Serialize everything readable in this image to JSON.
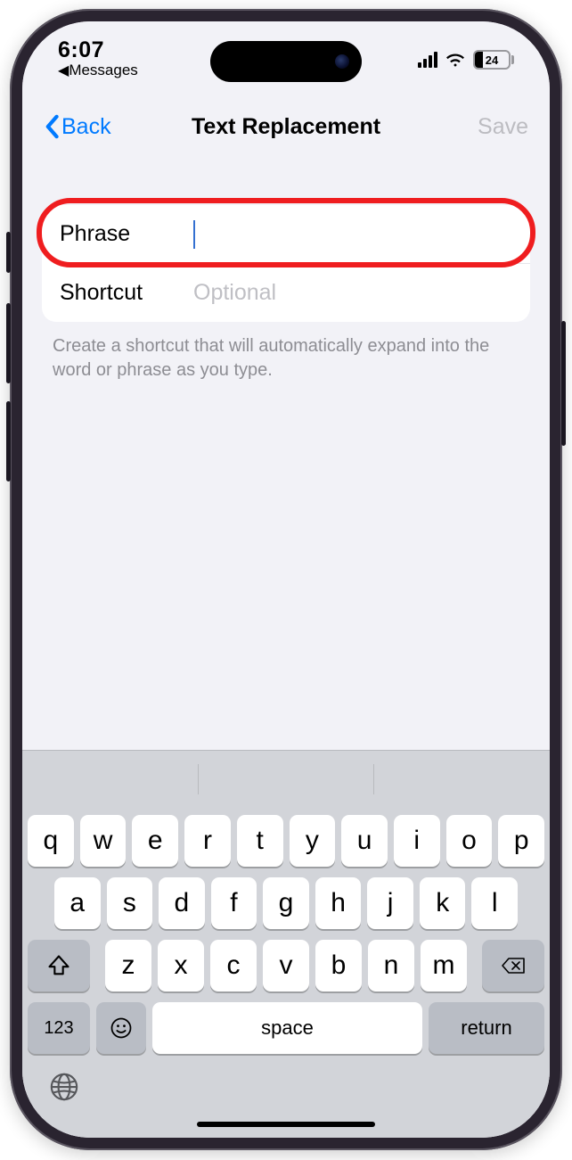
{
  "status": {
    "time": "6:07",
    "back_app_label": "Messages",
    "battery_percent": "24"
  },
  "nav": {
    "back_label": "Back",
    "title": "Text Replacement",
    "save_label": "Save"
  },
  "form": {
    "phrase_label": "Phrase",
    "phrase_value": "",
    "shortcut_label": "Shortcut",
    "shortcut_placeholder": "Optional",
    "shortcut_value": ""
  },
  "help_text": "Create a shortcut that will automatically expand into the word or phrase as you type.",
  "keyboard": {
    "row1": [
      "q",
      "w",
      "e",
      "r",
      "t",
      "y",
      "u",
      "i",
      "o",
      "p"
    ],
    "row2": [
      "a",
      "s",
      "d",
      "f",
      "g",
      "h",
      "j",
      "k",
      "l"
    ],
    "row3": [
      "z",
      "x",
      "c",
      "v",
      "b",
      "n",
      "m"
    ],
    "num_label": "123",
    "space_label": "space",
    "return_label": "return"
  }
}
